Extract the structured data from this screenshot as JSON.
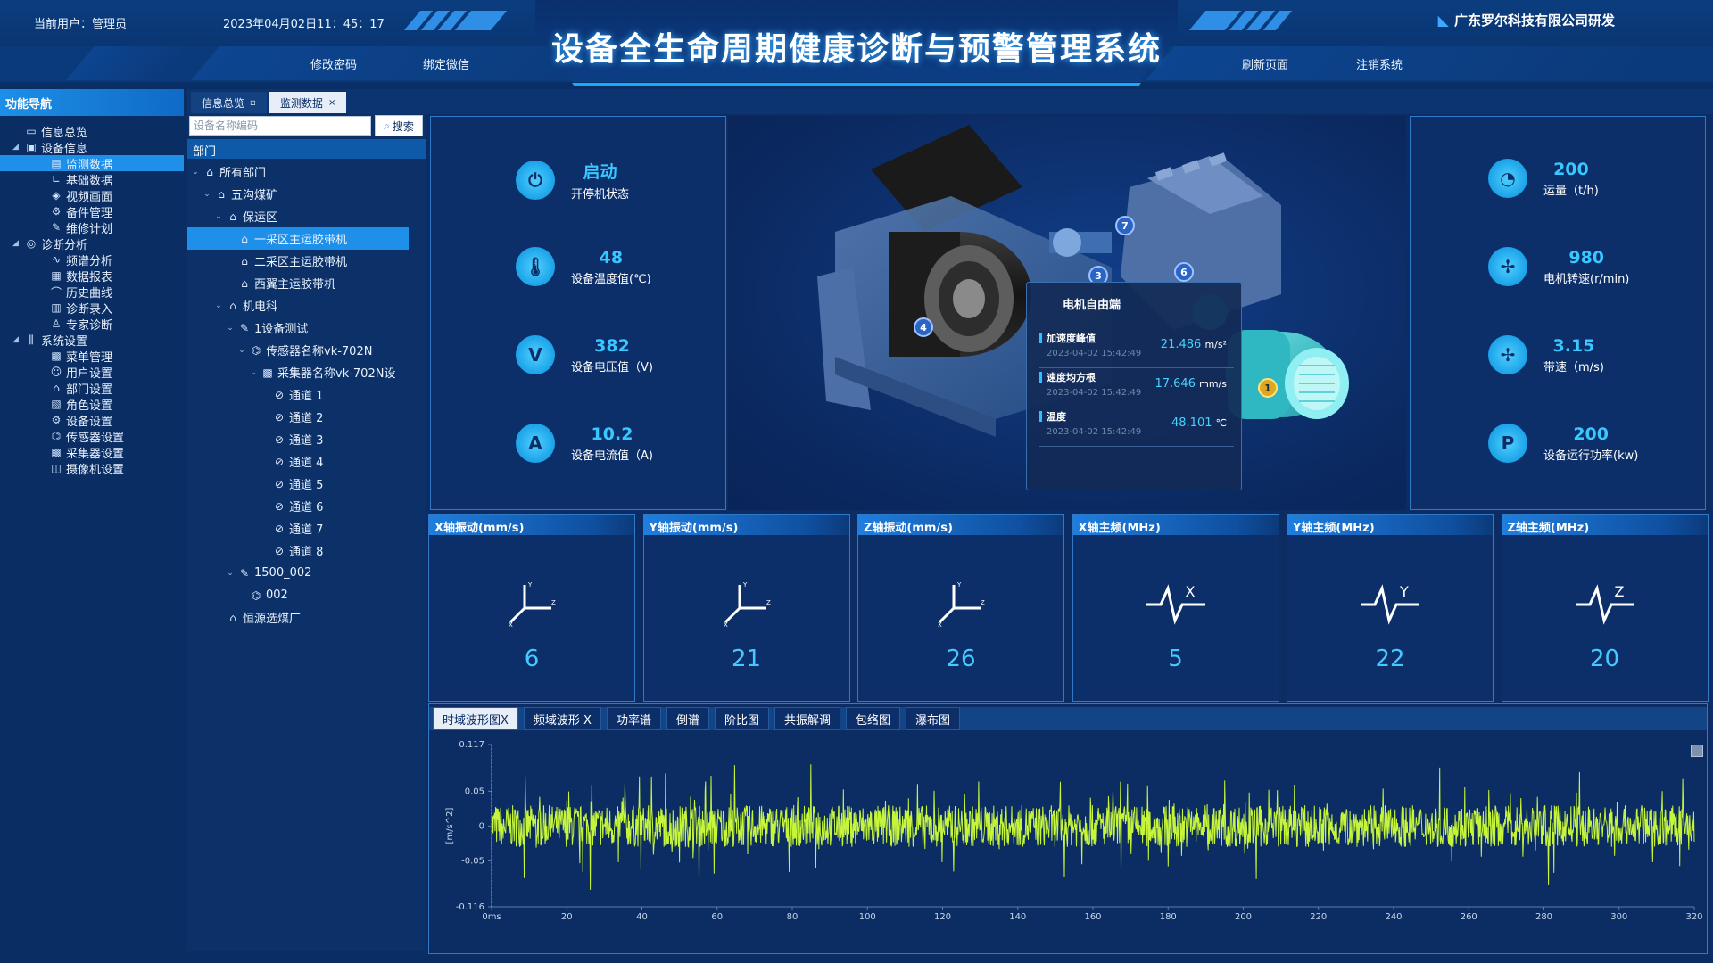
{
  "header": {
    "current_user": "当前用户：管理员",
    "datetime": "2023年04月02日11：45：17",
    "title": "设备全生命周期健康诊断与预警管理系统",
    "company": "广东罗尔科技有限公司研发",
    "buttons_left": [
      "修改密码",
      "绑定微信"
    ],
    "buttons_right": [
      "刷新页面",
      "注销系统"
    ]
  },
  "nav": {
    "title": "功能导航",
    "items": [
      {
        "label": "信息总览",
        "icon": "monitor-icon",
        "level": 1
      },
      {
        "label": "设备信息",
        "icon": "device-icon",
        "level": 0,
        "expanded": true
      },
      {
        "label": "监测数据",
        "icon": "monitor-data-icon",
        "level": 2,
        "selected": true
      },
      {
        "label": "基础数据",
        "icon": "chart-icon",
        "level": 2
      },
      {
        "label": "视频画面",
        "icon": "video-icon",
        "level": 2
      },
      {
        "label": "备件管理",
        "icon": "parts-icon",
        "level": 2
      },
      {
        "label": "维修计划",
        "icon": "wrench-icon",
        "level": 2
      },
      {
        "label": "诊断分析",
        "icon": "diagnosis-icon",
        "level": 0,
        "expanded": true
      },
      {
        "label": "频谱分析",
        "icon": "pulse-icon",
        "level": 2
      },
      {
        "label": "数据报表",
        "icon": "report-icon",
        "level": 2
      },
      {
        "label": "历史曲线",
        "icon": "curve-icon",
        "level": 2
      },
      {
        "label": "诊断录入",
        "icon": "entry-icon",
        "level": 2
      },
      {
        "label": "专家诊断",
        "icon": "expert-icon",
        "level": 2
      },
      {
        "label": "系统设置",
        "icon": "settings-icon",
        "level": 0,
        "expanded": true
      },
      {
        "label": "菜单管理",
        "icon": "menu-icon",
        "level": 2
      },
      {
        "label": "用户设置",
        "icon": "user-icon",
        "level": 2
      },
      {
        "label": "部门设置",
        "icon": "department-icon",
        "level": 2
      },
      {
        "label": "角色设置",
        "icon": "role-icon",
        "level": 2
      },
      {
        "label": "设备设置",
        "icon": "device-settings-icon",
        "level": 2
      },
      {
        "label": "传感器设置",
        "icon": "sensor-icon",
        "level": 2
      },
      {
        "label": "采集器设置",
        "icon": "collector-icon",
        "level": 2
      },
      {
        "label": "摄像机设置",
        "icon": "camera-icon",
        "level": 2
      }
    ]
  },
  "tabs": [
    {
      "label": "信息总览",
      "close": "▫",
      "active": false
    },
    {
      "label": "监测数据",
      "close": "×",
      "active": true
    }
  ],
  "tree": {
    "search_placeholder": "设备名称编码",
    "search_button": "搜索",
    "header": "部门",
    "items": [
      {
        "label": "所有部门",
        "level": 0,
        "icon": "building-icon",
        "toggle": "⌄"
      },
      {
        "label": "五沟煤矿",
        "level": 1,
        "icon": "building-icon",
        "toggle": "⌄"
      },
      {
        "label": "保运区",
        "level": 2,
        "icon": "building-icon",
        "toggle": "⌄"
      },
      {
        "label": "一采区主运胶带机",
        "level": 3,
        "icon": "building-icon",
        "toggle": "",
        "selected": true
      },
      {
        "label": "二采区主运胶带机",
        "level": 3,
        "icon": "building-icon",
        "toggle": ""
      },
      {
        "label": "西翼主运胶带机",
        "level": 3,
        "icon": "building-icon",
        "toggle": ""
      },
      {
        "label": "机电科",
        "level": 2,
        "icon": "building-icon",
        "toggle": "⌄"
      },
      {
        "label": "1设备测试",
        "level": 3,
        "icon": "wrench-icon",
        "toggle": "⌄"
      },
      {
        "label": "传感器名称vk-702N",
        "level": 4,
        "icon": "sensor-icon",
        "toggle": "⌄"
      },
      {
        "label": "采集器名称vk-702N设",
        "level": 5,
        "icon": "collector-icon",
        "toggle": "⌄"
      },
      {
        "label": "通道 1",
        "level": 6,
        "icon": "channel-icon",
        "toggle": ""
      },
      {
        "label": "通道 2",
        "level": 6,
        "icon": "channel-icon",
        "toggle": ""
      },
      {
        "label": "通道 3",
        "level": 6,
        "icon": "channel-icon",
        "toggle": ""
      },
      {
        "label": "通道 4",
        "level": 6,
        "icon": "channel-icon",
        "toggle": ""
      },
      {
        "label": "通道 5",
        "level": 6,
        "icon": "channel-icon",
        "toggle": ""
      },
      {
        "label": "通道 6",
        "level": 6,
        "icon": "channel-icon",
        "toggle": ""
      },
      {
        "label": "通道 7",
        "level": 6,
        "icon": "channel-icon",
        "toggle": ""
      },
      {
        "label": "通道 8",
        "level": 6,
        "icon": "channel-icon",
        "toggle": ""
      },
      {
        "label": "1500_002",
        "level": 3,
        "icon": "wrench-icon",
        "toggle": "⌄"
      },
      {
        "label": "002",
        "level": 4,
        "icon": "sensor-icon",
        "toggle": ""
      },
      {
        "label": "恒源选煤厂",
        "level": 2,
        "icon": "building-icon",
        "toggle": ""
      }
    ]
  },
  "stats_left": [
    {
      "value": "启动",
      "label": "开停机状态",
      "icon": "power-icon"
    },
    {
      "value": "48",
      "label": "设备温度值(℃)",
      "icon": "thermometer-icon"
    },
    {
      "value": "382",
      "label": "设备电压值（V)",
      "icon": "voltage-icon"
    },
    {
      "value": "10.2",
      "label": "设备电流值（A)",
      "icon": "current-icon"
    }
  ],
  "stats_right": [
    {
      "value": "200",
      "label": "运量（t/h)",
      "icon": "gauge-icon"
    },
    {
      "value": "980",
      "label": "电机转速(r/min)",
      "icon": "fan-icon"
    },
    {
      "value": "3.15",
      "label": "带速（m/s)",
      "icon": "fan-icon"
    },
    {
      "value": "200",
      "label": "设备运行功率(kw)",
      "icon": "power-p-icon"
    }
  ],
  "popup": {
    "title": "电机自由端",
    "rows": [
      {
        "name": "加速度峰值",
        "time": "2023-04-02 15:42:49",
        "value": "21.486",
        "unit": "m/s²"
      },
      {
        "name": "速度均方根",
        "time": "2023-04-02 15:42:49",
        "value": "17.646",
        "unit": "mm/s"
      },
      {
        "name": "温度",
        "time": "2023-04-02 15:42:49",
        "value": "48.101",
        "unit": "℃"
      }
    ]
  },
  "badges": [
    "7",
    "3",
    "6",
    "4",
    "1"
  ],
  "vibration": [
    {
      "title": "X轴振动(mm/s)",
      "value": "6",
      "icon": "axes-icon"
    },
    {
      "title": "Y轴振动(mm/s)",
      "value": "21",
      "icon": "axes-icon"
    },
    {
      "title": "Z轴振动(mm/s)",
      "value": "26",
      "icon": "axes-icon"
    },
    {
      "title": "X轴主频(MHz)",
      "value": "5",
      "icon": "wave-icon",
      "axis": "X"
    },
    {
      "title": "Y轴主频(MHz)",
      "value": "22",
      "icon": "wave-icon",
      "axis": "Y"
    },
    {
      "title": "Z轴主频(MHz)",
      "value": "20",
      "icon": "wave-icon",
      "axis": "Z"
    }
  ],
  "chart_tabs": [
    "时域波形图X",
    "频域波形 X",
    "功率谱",
    "倒谱",
    "阶比图",
    "共振解调",
    "包络图",
    "瀑布图"
  ],
  "chart_data": {
    "type": "line",
    "title": "",
    "xlabel": "",
    "ylabel": "[m/s^2]",
    "xlim": [
      0,
      320
    ],
    "ylim": [
      -0.116,
      0.117
    ],
    "x_ticks": [
      "0ms",
      "20",
      "40",
      "60",
      "80",
      "100",
      "120",
      "140",
      "160",
      "180",
      "200",
      "220",
      "240",
      "260",
      "280",
      "300",
      "320"
    ],
    "y_ticks": [
      "0.117",
      "0.05",
      "0",
      "-0.05",
      "-0.116"
    ],
    "series": [
      {
        "color": "#c6f53a",
        "amplitude_band": [
          -0.03,
          0.03
        ],
        "peak_range": [
          -0.1,
          0.1
        ]
      }
    ],
    "grid": false
  },
  "colors": {
    "accent": "#39c7ff",
    "signal": "#c6f53a",
    "panel_border": "#2f79c9"
  }
}
